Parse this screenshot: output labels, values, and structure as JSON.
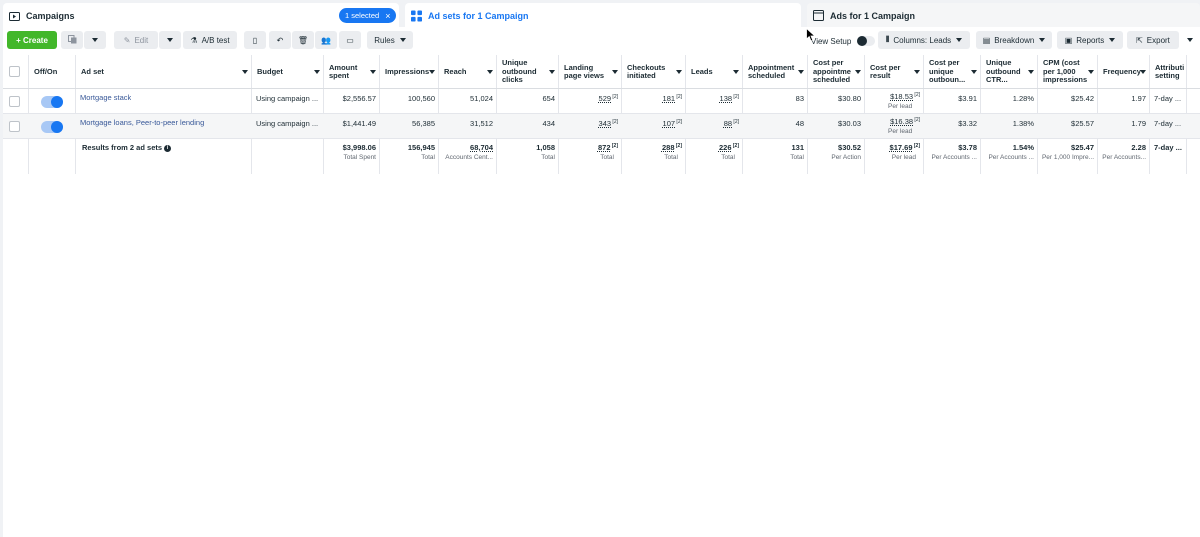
{
  "tabs": {
    "campaigns": "Campaigns",
    "selected_badge": "1 selected",
    "adsets": "Ad sets for 1 Campaign",
    "ads": "Ads for 1 Campaign"
  },
  "toolbar": {
    "create": "+ Create",
    "edit": "Edit",
    "ab_test": "A/B test",
    "rules": "Rules",
    "view_setup": "View Setup",
    "columns": "Columns: Leads",
    "breakdown": "Breakdown",
    "reports": "Reports",
    "export": "Export"
  },
  "headers": {
    "offon": "Off/On",
    "adset": "Ad set",
    "budget": "Budget",
    "amount": "Amount spent",
    "impressions": "Impressions",
    "reach": "Reach",
    "uoc": "Unique outbound clicks",
    "lpv": "Landing page views",
    "checkouts": "Checkouts initiated",
    "leads": "Leads",
    "appt": "Appointment scheduled",
    "cpas": "Cost per appointme scheduled",
    "cpr": "Cost per result",
    "cpuo": "Cost per unique outboun...",
    "uoctr": "Unique outbound CTR...",
    "cpm": "CPM (cost per 1,000 impressions",
    "freq": "Frequency",
    "attr": "Attributi setting"
  },
  "rows": [
    {
      "name": "Mortgage stack",
      "budget": "Using campaign ...",
      "amount": "$2,556.57",
      "impressions": "100,560",
      "reach": "51,024",
      "uoc": "654",
      "lpv": "529",
      "checkouts": "181",
      "leads": "138",
      "appt": "83",
      "cpas": "$30.80",
      "cpr": "$18.53",
      "cpr_sub": "Per lead",
      "cpuo": "$3.91",
      "uoctr": "1.28%",
      "cpm": "$25.42",
      "freq": "1.97",
      "attr": "7-day ..."
    },
    {
      "name": "Mortgage loans, Peer-to-peer lending",
      "budget": "Using campaign ...",
      "amount": "$1,441.49",
      "impressions": "56,385",
      "reach": "31,512",
      "uoc": "434",
      "lpv": "343",
      "checkouts": "107",
      "leads": "88",
      "appt": "48",
      "cpas": "$30.03",
      "cpr": "$16.38",
      "cpr_sub": "Per lead",
      "cpuo": "$3.32",
      "uoctr": "1.38%",
      "cpm": "$25.57",
      "freq": "1.79",
      "attr": "7-day ..."
    }
  ],
  "totals": {
    "label": "Results from 2 ad sets",
    "amount": "$3,998.06",
    "amount_sub": "Total Spent",
    "impressions": "156,945",
    "impressions_sub": "Total",
    "reach": "68,704",
    "reach_sub": "Accounts Cent...",
    "uoc": "1,058",
    "uoc_sub": "Total",
    "lpv": "872",
    "lpv_sub": "Total",
    "checkouts": "288",
    "checkouts_sub": "Total",
    "leads": "226",
    "leads_sub": "Total",
    "appt": "131",
    "appt_sub": "Total",
    "cpas": "$30.52",
    "cpas_sub": "Per Action",
    "cpr": "$17.69",
    "cpr_sub": "Per lead",
    "cpuo": "$3.78",
    "cpuo_sub": "Per Accounts ...",
    "uoctr": "1.54%",
    "uoctr_sub": "Per Accounts ...",
    "cpm": "$25.47",
    "cpm_sub": "Per 1,000 Impre...",
    "freq": "2.28",
    "freq_sub": "Per Accounts...",
    "attr": "7-day ..."
  },
  "colors": {
    "accent": "#1877f2",
    "create": "#42b72a",
    "link": "#385898"
  }
}
